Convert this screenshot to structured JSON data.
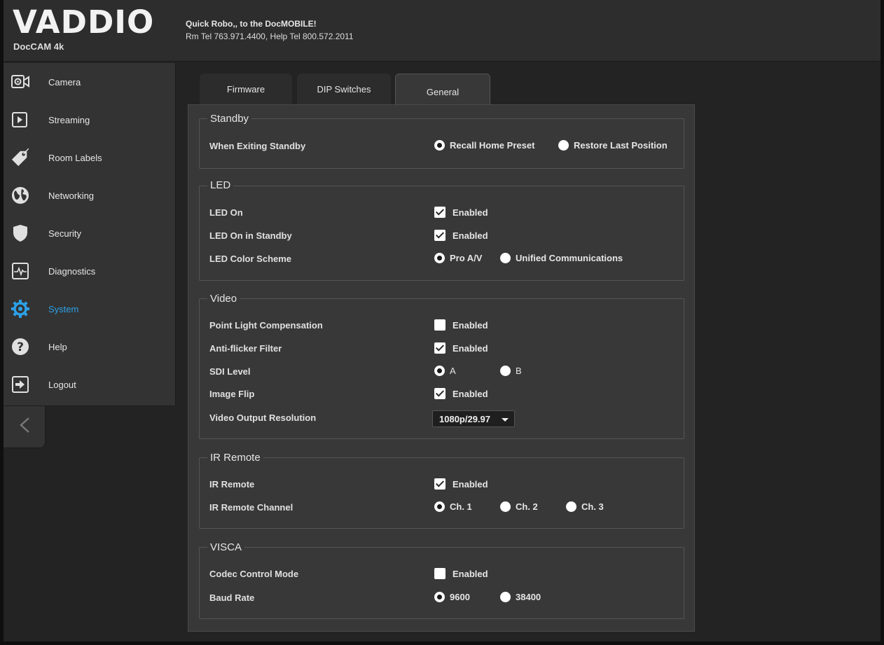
{
  "header": {
    "logo": "VADDIO",
    "product": "DocCAM 4k",
    "line1": "Quick Robo,, to the DocMOBILE!",
    "line2": "Rm Tel 763.971.4400, Help Tel 800.572.2011"
  },
  "sidebar": {
    "items": [
      {
        "label": "Camera",
        "icon": "camera-icon"
      },
      {
        "label": "Streaming",
        "icon": "play-icon"
      },
      {
        "label": "Room Labels",
        "icon": "tag-icon"
      },
      {
        "label": "Networking",
        "icon": "globe-icon"
      },
      {
        "label": "Security",
        "icon": "shield-icon"
      },
      {
        "label": "Diagnostics",
        "icon": "pulse-icon"
      },
      {
        "label": "System",
        "icon": "gear-icon",
        "active": true
      },
      {
        "label": "Help",
        "icon": "help-icon"
      },
      {
        "label": "Logout",
        "icon": "logout-icon"
      }
    ],
    "collapse_icon": "chevron-left-icon"
  },
  "tabs": [
    {
      "label": "Firmware"
    },
    {
      "label": "DIP Switches"
    },
    {
      "label": "General",
      "active": true
    }
  ],
  "standby": {
    "legend": "Standby",
    "exiting_label": "When Exiting Standby",
    "options": [
      "Recall Home Preset",
      "Restore Last Position"
    ],
    "selected": "Recall Home Preset"
  },
  "led": {
    "legend": "LED",
    "led_on_label": "LED On",
    "led_on_value": "Enabled",
    "standby_label": "LED On in Standby",
    "standby_value": "Enabled",
    "scheme_label": "LED Color Scheme",
    "scheme_options": [
      "Pro A/V",
      "Unified Communications"
    ],
    "scheme_selected": "Pro A/V"
  },
  "video": {
    "legend": "Video",
    "plc_label": "Point Light Compensation",
    "plc_value": "Enabled",
    "flicker_label": "Anti-flicker Filter",
    "flicker_value": "Enabled",
    "sdi_label": "SDI Level",
    "sdi_options": [
      "A",
      "B"
    ],
    "sdi_selected": "A",
    "flip_label": "Image Flip",
    "flip_value": "Enabled",
    "resolution_label": "Video Output Resolution",
    "resolution_value": "1080p/29.97"
  },
  "ir": {
    "legend": "IR Remote",
    "remote_label": "IR Remote",
    "remote_value": "Enabled",
    "channel_label": "IR Remote Channel",
    "channel_options": [
      "Ch. 1",
      "Ch. 2",
      "Ch. 3"
    ],
    "channel_selected": "Ch. 1"
  },
  "visca": {
    "legend": "VISCA",
    "codec_label": "Codec Control Mode",
    "codec_value": "Enabled",
    "baud_label": "Baud Rate",
    "baud_options": [
      "9600",
      "38400"
    ],
    "baud_selected": "9600"
  },
  "colors": {
    "accent": "#2da1e8",
    "background": "#232323",
    "panel": "#383838",
    "sidebar": "#333333"
  }
}
